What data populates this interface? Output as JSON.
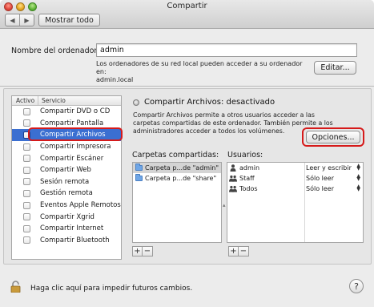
{
  "window": {
    "title": "Compartir",
    "show_all_label": "Mostrar todo",
    "back_arrow": "◀",
    "forward_arrow": "▶"
  },
  "computer_name": {
    "label": "Nombre del ordenador:",
    "value": "admin",
    "info_line1": "Los ordenadores de su red local pueden acceder a su ordenador en:",
    "info_line2": "admin.local",
    "edit_button": "Editar..."
  },
  "services": {
    "header_active": "Activo",
    "header_service": "Servicio",
    "items": [
      {
        "label": "Compartir DVD o CD",
        "checked": false,
        "selected": false
      },
      {
        "label": "Compartir Pantalla",
        "checked": false,
        "selected": false
      },
      {
        "label": "Compartir Archivos",
        "checked": false,
        "selected": true
      },
      {
        "label": "Compartir Impresora",
        "checked": false,
        "selected": false
      },
      {
        "label": "Compartir Escáner",
        "checked": false,
        "selected": false
      },
      {
        "label": "Compartir Web",
        "checked": false,
        "selected": false
      },
      {
        "label": "Sesión remota",
        "checked": false,
        "selected": false
      },
      {
        "label": "Gestión remota",
        "checked": false,
        "selected": false
      },
      {
        "label": "Eventos Apple Remotos",
        "checked": false,
        "selected": false
      },
      {
        "label": "Compartir Xgrid",
        "checked": false,
        "selected": false
      },
      {
        "label": "Compartir Internet",
        "checked": false,
        "selected": false
      },
      {
        "label": "Compartir Bluetooth",
        "checked": false,
        "selected": false
      }
    ]
  },
  "detail": {
    "status": "Compartir Archivos: desactivado",
    "description": "Compartir Archivos permite a otros usuarios acceder a las carpetas compartidas de este ordenador. También permite a los administradores acceder a todos los volúmenes.",
    "options_button": "Opciones...",
    "folders_label": "Carpetas compartidas:",
    "users_label": "Usuarios:",
    "folders": [
      {
        "label": "Carpeta p...de \"admin\"",
        "selected": true
      },
      {
        "label": "Carpeta p...de \"share\"",
        "selected": false
      }
    ],
    "users": [
      {
        "name": "admin",
        "icon": "single-user-icon",
        "permission": "Leer y escribir"
      },
      {
        "name": "Staff",
        "icon": "group-icon",
        "permission": "Sólo leer"
      },
      {
        "name": "Todos",
        "icon": "everyone-icon",
        "permission": "Sólo leer"
      }
    ],
    "add_symbol": "+",
    "remove_symbol": "−"
  },
  "footer": {
    "lock_text": "Haga clic aquí para impedir futuros cambios.",
    "help_symbol": "?"
  },
  "colors": {
    "selection": "#3b6fd1",
    "highlight_annotation": "#d61a1a"
  }
}
